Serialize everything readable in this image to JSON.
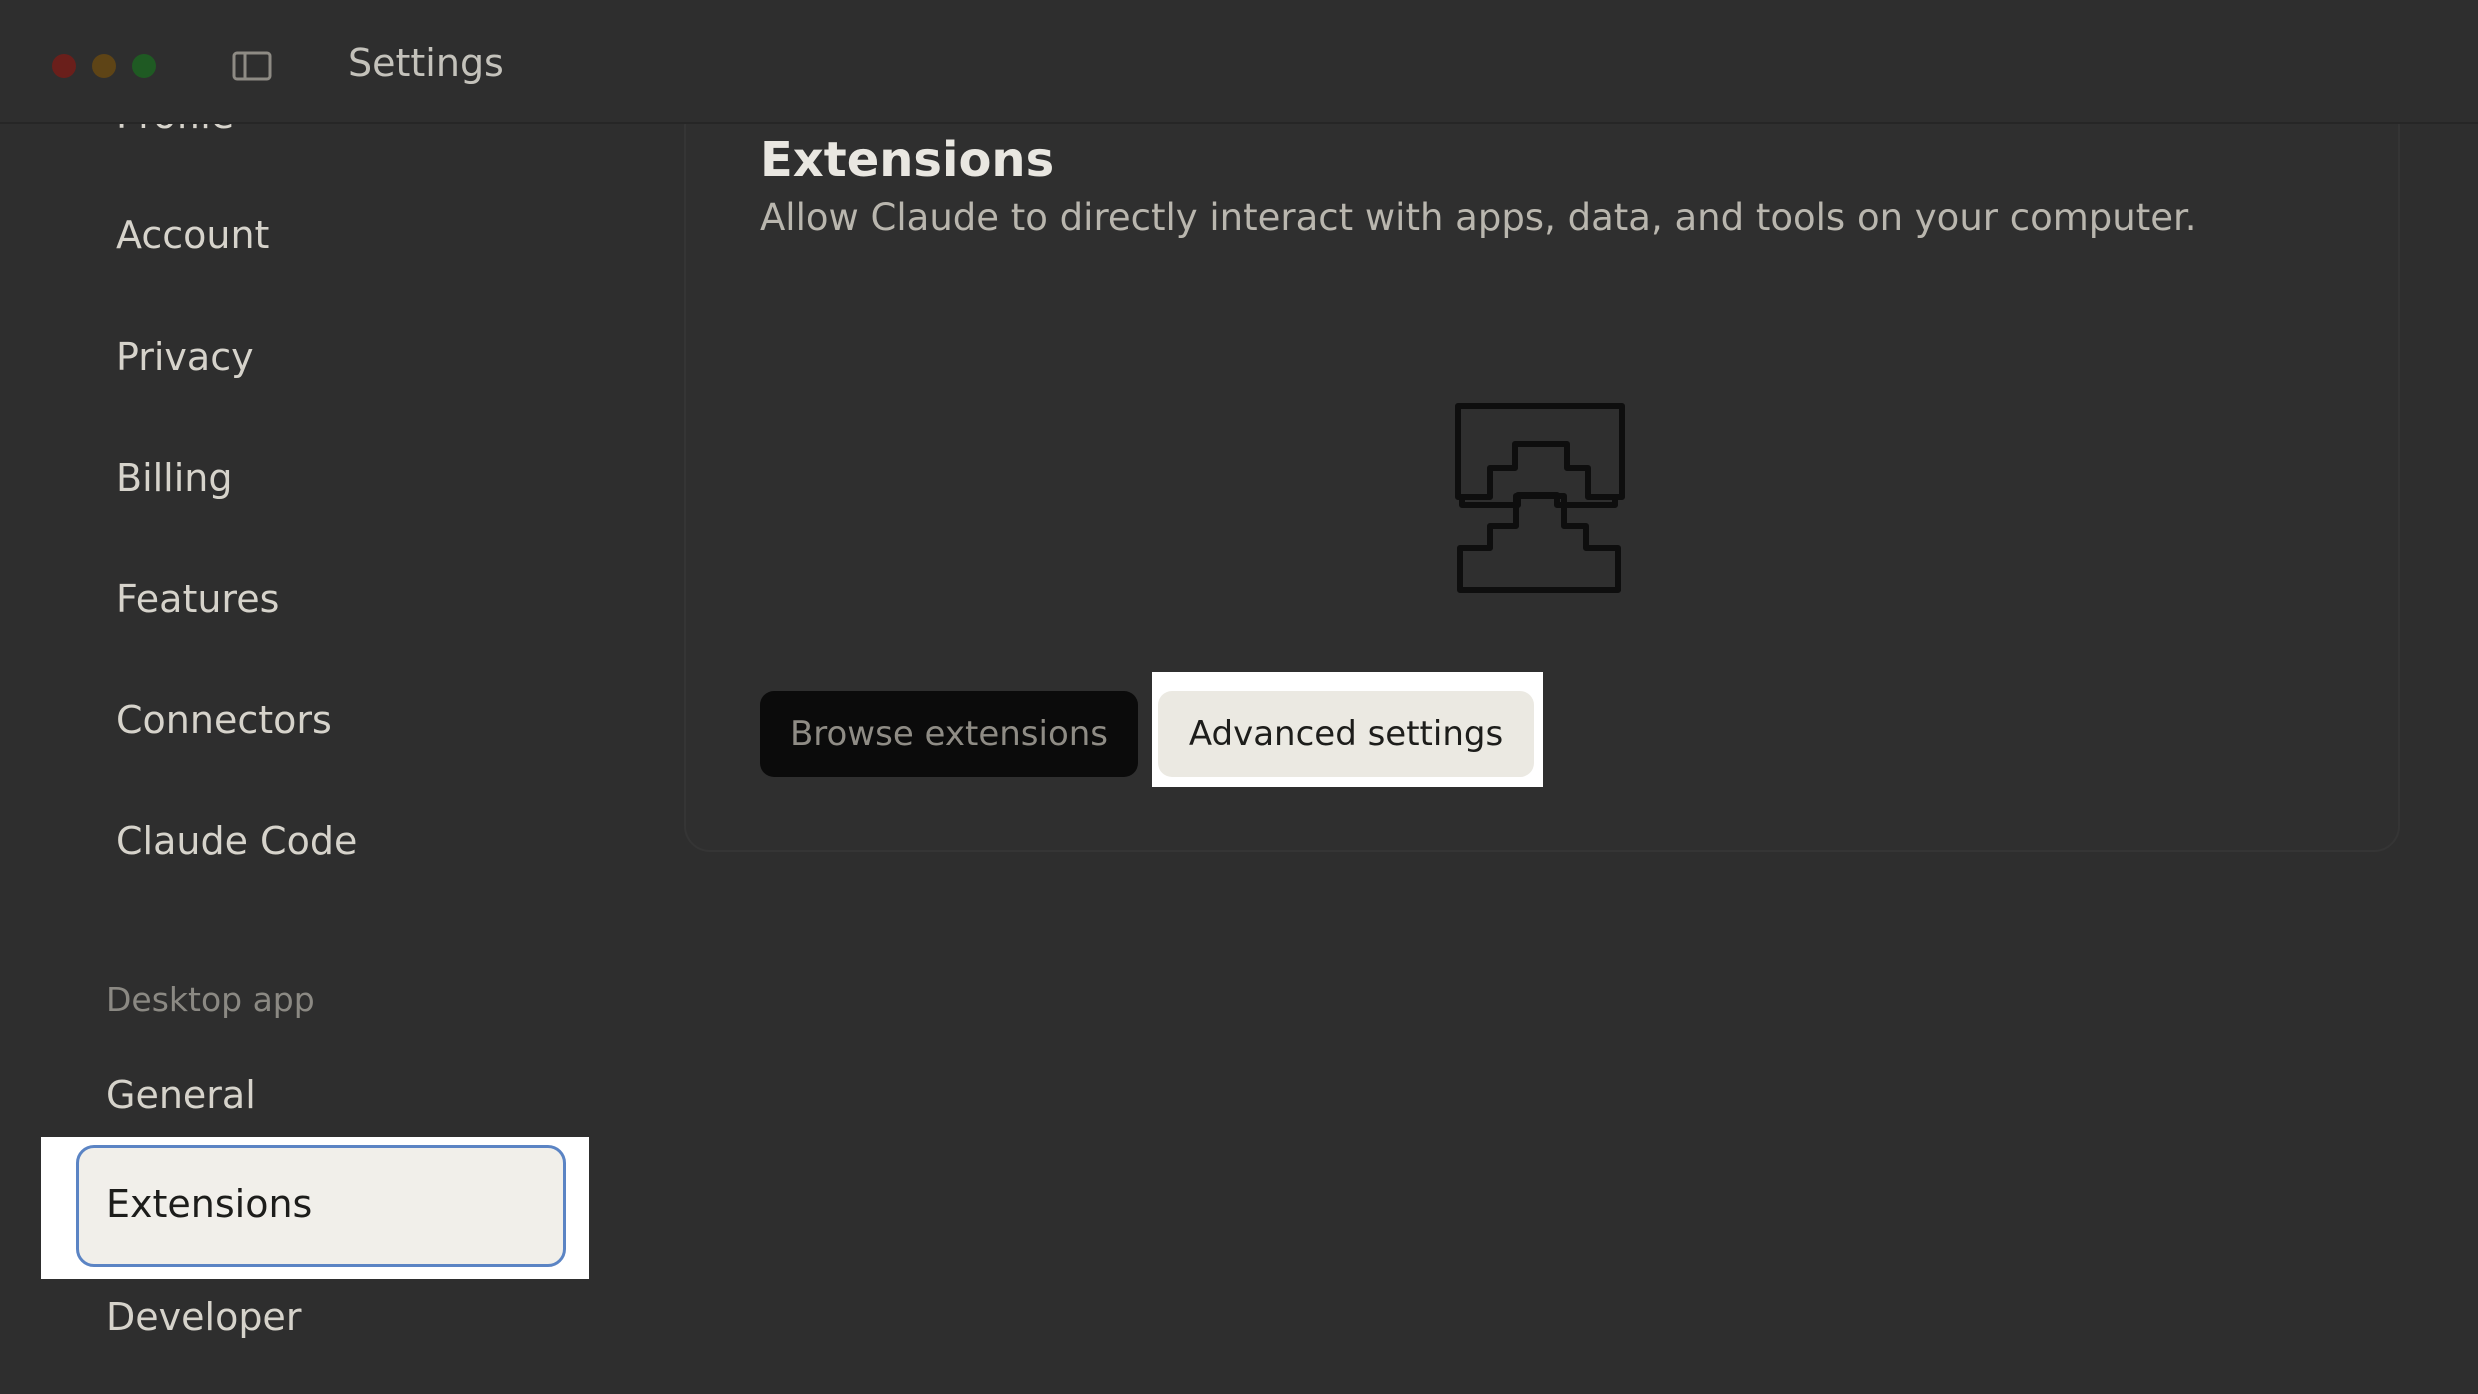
{
  "window": {
    "title": "Settings"
  },
  "sidebar": {
    "items": [
      {
        "label": "Profile"
      },
      {
        "label": "Account"
      },
      {
        "label": "Privacy"
      },
      {
        "label": "Billing"
      },
      {
        "label": "Features"
      },
      {
        "label": "Connectors"
      },
      {
        "label": "Claude Code"
      }
    ],
    "desktop_section_label": "Desktop app",
    "desktop_items": [
      {
        "label": "General"
      },
      {
        "label": "Extensions",
        "active": true
      },
      {
        "label": "Developer"
      }
    ]
  },
  "main": {
    "title": "Extensions",
    "subtitle": "Allow Claude to directly interact with apps, data, and tools on your computer.",
    "illustration_icon": "puzzle-stack-icon",
    "browse_button_label": "Browse extensions",
    "advanced_button_label": "Advanced settings"
  },
  "colors": {
    "background": "#2e2e2e",
    "active_item_bg": "#f1efea",
    "active_item_border": "#5b84c4",
    "primary_button_bg": "#0b0b0b",
    "secondary_button_bg": "#ebe9e2"
  }
}
